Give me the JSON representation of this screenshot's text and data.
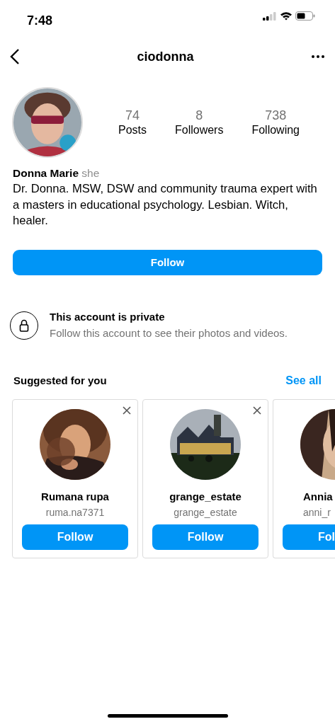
{
  "status_bar": {
    "time": "7:48"
  },
  "nav": {
    "title": "ciodonna"
  },
  "profile": {
    "stats": [
      {
        "value": "74",
        "label": "Posts"
      },
      {
        "value": "8",
        "label": "Followers"
      },
      {
        "value": "738",
        "label": "Following"
      }
    ],
    "name": "Donna Marie",
    "pronouns": "she",
    "bio": "Dr. Donna. MSW, DSW and community trauma expert with a masters in educational psychology. Lesbian. Witch, healer.",
    "follow_button": "Follow"
  },
  "private": {
    "title": "This account is private",
    "text": "Follow this account to see their photos and videos."
  },
  "suggested": {
    "title": "Suggested for you",
    "see_all": "See all",
    "cards": [
      {
        "name": "Rumana rupa",
        "username": "ruma.na7371",
        "button": "Follow",
        "dismissible": true,
        "cut": false
      },
      {
        "name": "grange_estate",
        "username": "grange_estate",
        "button": "Follow",
        "dismissible": true,
        "cut": false
      },
      {
        "name": "Annia",
        "username": "anni_r",
        "button": "Fol",
        "dismissible": false,
        "cut": true
      }
    ]
  }
}
